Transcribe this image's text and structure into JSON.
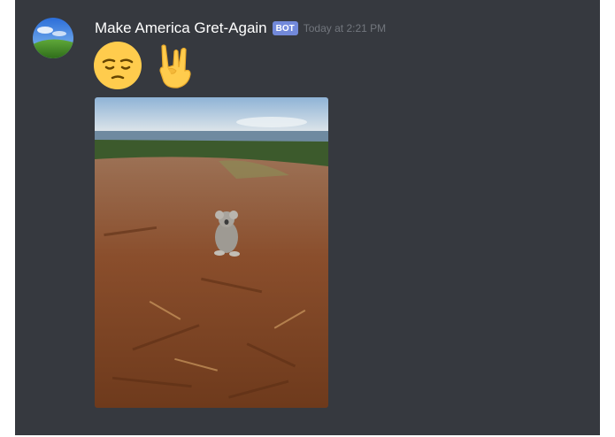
{
  "message": {
    "author": "Make America Gret-Again",
    "bot_tag": "BOT",
    "timestamp": "Today at 2:21 PM",
    "avatar_icon": "windows-xp-bliss-avatar",
    "emojis": [
      {
        "name": "pensive-face-icon"
      },
      {
        "name": "sign-of-the-horns-icon"
      }
    ],
    "attachment": {
      "type": "image",
      "description_icon": "koala-photo"
    }
  },
  "colors": {
    "chat_background": "#36393f",
    "bot_tag": "#7289da",
    "username": "#ffffff",
    "timestamp": "#72767d"
  }
}
